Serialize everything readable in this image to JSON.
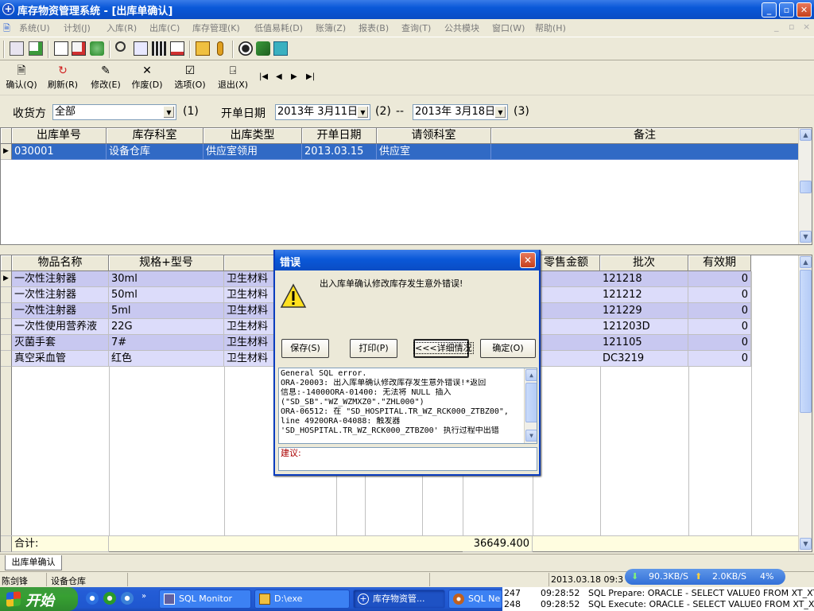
{
  "window": {
    "title": "库存物资管理系统 - [出库单确认]"
  },
  "menu": [
    {
      "label": "系统(U)"
    },
    {
      "label": "计划(J)"
    },
    {
      "label": "入库(R)"
    },
    {
      "label": "出库(C)"
    },
    {
      "label": "库存管理(K)"
    },
    {
      "label": "低值易耗(D)"
    },
    {
      "label": "账簿(Z)"
    },
    {
      "label": "报表(B)"
    },
    {
      "label": "查询(T)"
    },
    {
      "label": "公共模块"
    },
    {
      "label": "窗口(W)"
    },
    {
      "label": "帮助(H)"
    }
  ],
  "toolbar": {
    "confirm": "确认(Q)",
    "refresh": "刷新(R)",
    "modify": "修改(E)",
    "void": "作废(D)",
    "options": "选项(O)",
    "exit": "退出(X)"
  },
  "filter": {
    "receiver_label": "收货方",
    "receiver_value": "全部",
    "key1": "(1)",
    "date_label": "开单日期",
    "date_from": "2013年 3月11日",
    "key2": "(2)",
    "dash": "--",
    "date_to": "2013年 3月18日",
    "key3": "(3)"
  },
  "master": {
    "headers": [
      "出库单号",
      "库存科室",
      "出库类型",
      "开单日期",
      "请领科室",
      "备注"
    ],
    "rows": [
      [
        "030001",
        "设备仓库",
        "供应室领用",
        "2013.03.15",
        "供应室",
        ""
      ]
    ]
  },
  "detail": {
    "headers": [
      "物品名称",
      "规格+型号",
      "类",
      "",
      "",
      "",
      "",
      "零售金额",
      "批次",
      "有效期"
    ],
    "rows": [
      {
        "name": "一次性注射器",
        "spec": "30ml",
        "cat": "卫生材料",
        "batch": "121218",
        "valid": "0"
      },
      {
        "name": "一次性注射器",
        "spec": "50ml",
        "cat": "卫生材料",
        "batch": "121212",
        "valid": "0"
      },
      {
        "name": "一次性注射器",
        "spec": "5ml",
        "cat": "卫生材料",
        "batch": "121229",
        "valid": "0"
      },
      {
        "name": "一次性使用营养液",
        "spec": "22G",
        "cat": "卫生材料",
        "batch": "121203D",
        "valid": "0"
      },
      {
        "name": "灭菌手套",
        "spec": "7#",
        "cat": "卫生材料",
        "batch": "121105",
        "valid": "0"
      },
      {
        "name": "真空采血管",
        "spec": "红色",
        "cat": "卫生材料",
        "batch": "DC3219",
        "valid": "0"
      }
    ],
    "total_label": "合计:",
    "total_value": "36649.400"
  },
  "dialog": {
    "title": "错误",
    "message": "出入库单确认修改库存发生意外错误!",
    "buttons": {
      "save": "保存(S)",
      "print": "打印(P)",
      "details": "<<<详细情况",
      "ok": "确定(O)"
    },
    "details_lines": [
      "General SQL error.",
      "ORA-20003: 出入库单确认修改库存发生意外错误!*返回",
      "信息:-14000ORA-01400: 无法将 NULL 插入",
      "(\"SD_SB\".\"WZ_WZMXZ0\".\"ZHL000\")",
      "ORA-06512: 在 \"SD_HOSPITAL.TR_WZ_RCK000_ZTBZ00\",",
      "line 4920ORA-04088: 触发器",
      "'SD_HOSPITAL.TR_WZ_RCK000_ZTBZ00' 执行过程中出错"
    ],
    "suggestion_label": "建议:"
  },
  "tab": {
    "label": "出库单确认"
  },
  "status": {
    "user": "陈剑锋",
    "dept": "设备仓库",
    "datetime": "2013.03.18 09:3",
    "down_speed": "90.3KB/S",
    "up_speed": "2.0KB/S",
    "percent": "4%"
  },
  "taskbar": {
    "start": "开始",
    "tasks": [
      {
        "label": "SQL Monitor"
      },
      {
        "label": "D:\\exe"
      },
      {
        "label": "库存物资管..."
      },
      {
        "label": "SQL Ne"
      }
    ],
    "log": [
      {
        "id": "247",
        "time": "09:28:52",
        "text": "SQL Prepare: ORACLE - SELECT VALUE0 FROM XT_XTCS"
      },
      {
        "id": "248",
        "time": "09:28:52",
        "text": "SQL Execute: ORACLE - SELECT VALUE0 FROM XT_XTCS"
      }
    ]
  },
  "colors": {
    "titlebar": "#0a58d8",
    "selection": "#316ac5",
    "stripe_dark": "#c8c8f0",
    "stripe_light": "#dcdcfa",
    "error_text": "#aa0000"
  }
}
